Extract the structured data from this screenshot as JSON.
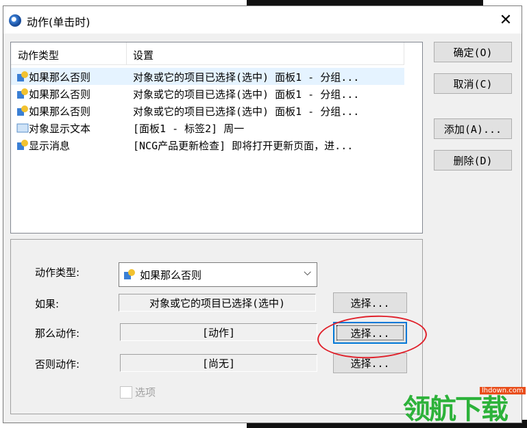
{
  "window": {
    "title": "动作(单击时)"
  },
  "buttons": {
    "ok": "确定(O)",
    "cancel": "取消(C)",
    "add": "添加(A)...",
    "delete": "删除(D)"
  },
  "list": {
    "headers": [
      "动作类型",
      "设置"
    ],
    "rows": [
      {
        "name": "如果那么否则",
        "setting": "对象或它的项目已选择(选中) 面板1 - 分组...",
        "icon": "if-then-icon",
        "selected": true
      },
      {
        "name": "如果那么否则",
        "setting": "对象或它的项目已选择(选中) 面板1 - 分组...",
        "icon": "if-then-icon",
        "selected": false
      },
      {
        "name": "如果那么否则",
        "setting": "对象或它的项目已选择(选中) 面板1 - 分组...",
        "icon": "if-then-icon",
        "selected": false
      },
      {
        "name": "对象显示文本",
        "setting": "[面板1 - 标签2] 周一",
        "icon": "text-display-icon",
        "selected": false
      },
      {
        "name": "显示消息",
        "setting": "[NCG产品更新检查] 即将打开更新页面，进...",
        "icon": "message-icon",
        "selected": false
      }
    ]
  },
  "form": {
    "action_type_label": "动作类型:",
    "action_type_value": "如果那么否则",
    "if_label": "如果:",
    "if_value": "对象或它的项目已选择(选中)",
    "then_label": "那么动作:",
    "then_value": "[动作]",
    "else_label": "否则动作:",
    "else_value": "[尚无]",
    "select_label": "选择...",
    "option_label": "选项"
  },
  "watermark": {
    "brand": "领航下载",
    "site": "lhdown.com"
  },
  "colors": {
    "accent": "#0078d7",
    "selection": "#e5f3ff",
    "annotation": "#e0202a",
    "watermark": "#2db23a"
  }
}
